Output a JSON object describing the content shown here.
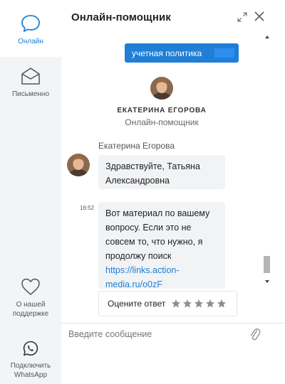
{
  "sidebar": {
    "online_label": "Онлайн",
    "written_label": "Письменно",
    "support_label": "О нашей поддержке",
    "whatsapp_label": "Подключить WhatsApp"
  },
  "header": {
    "title": "Онлайн-помощник"
  },
  "chat": {
    "policy_button": "учетная политика",
    "operator_name": "ЕКАТЕРИНА ЕГОРОВА",
    "operator_role": "Онлайн-помощник",
    "sender_name": "Екатерина Егорова",
    "message1": "Здравствуйте, Татьяна Александровна",
    "message2_time": "16:52",
    "message2_text": "Вот материал по вашему вопросу. Если это не совсем то, что нужно, я продолжу поиск",
    "message2_link": "https://links.action-media.ru/o0zF",
    "rate_label": "Оцените ответ",
    "stars": 5
  },
  "composer": {
    "placeholder": "Введите сообщение"
  },
  "colors": {
    "accent": "#1f7fd6",
    "sidebar_bg": "#f2f4f7",
    "bubble_bg": "#f1f3f5"
  },
  "icons": {
    "online": "chat-bubble-icon",
    "written": "envelope-icon",
    "support": "heart-icon",
    "whatsapp": "whatsapp-icon",
    "expand": "expand-icon",
    "close": "close-icon",
    "attach": "paperclip-icon",
    "star": "star-icon"
  }
}
